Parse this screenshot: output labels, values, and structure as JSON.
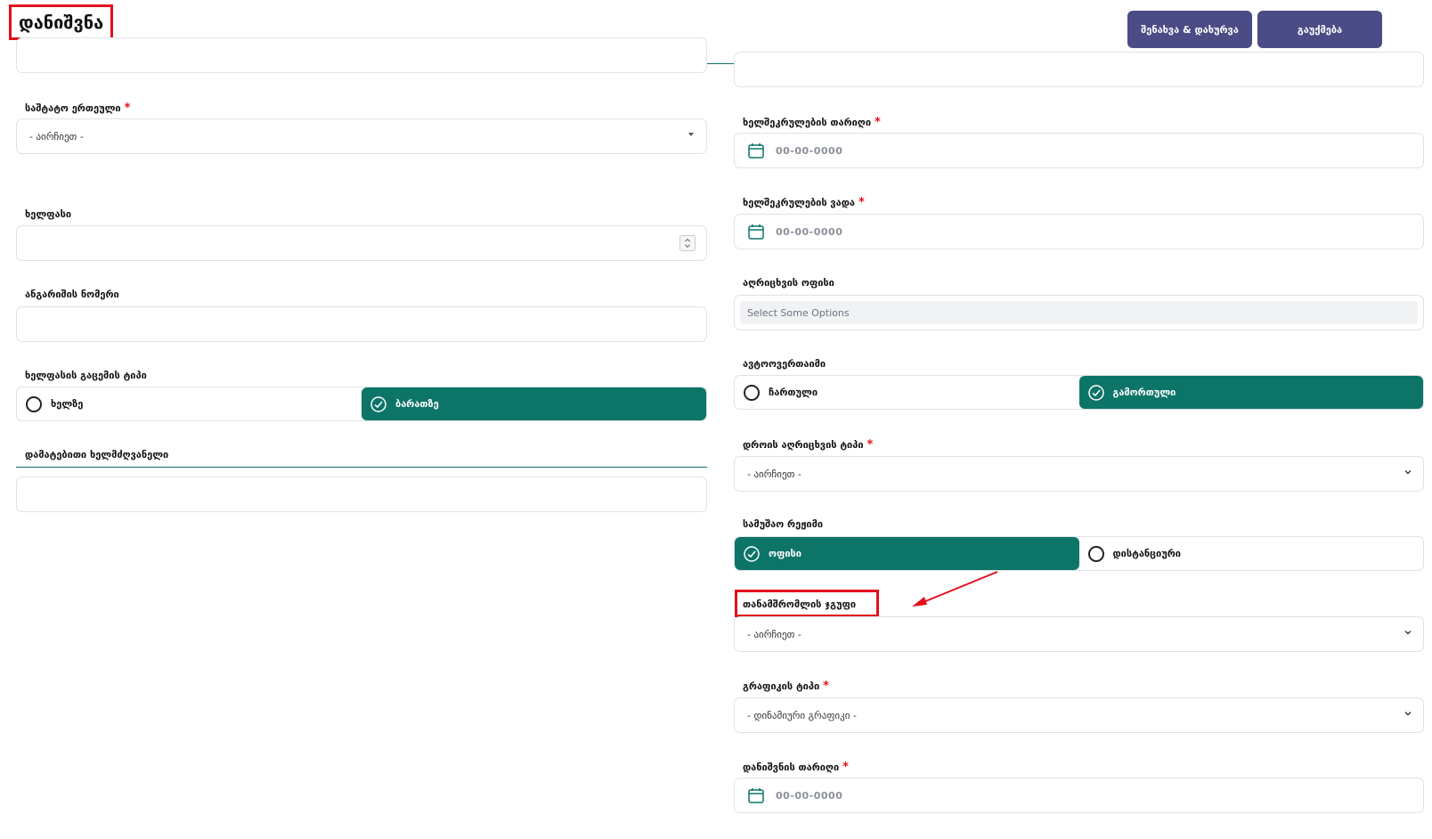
{
  "header": {
    "title": "დანიშვნა",
    "save_close_label": "შენახვა & დახურვა",
    "cancel_label": "გაუქმება"
  },
  "left": {
    "staff_unit": {
      "label": "საშტატო ერთეული",
      "value": "- აირჩიეთ -"
    },
    "salary": {
      "label": "ხელფასი",
      "value": ""
    },
    "account_number": {
      "label": "ანგარიშის ნომერი",
      "value": ""
    },
    "salary_type": {
      "label": "ხელფასის გაცემის ტიპი",
      "options": [
        "ხელზე",
        "ბარათზე"
      ],
      "selected": "ბარათზე"
    },
    "additional_manager": {
      "label": "დამატებითი ხელმძღვანელი",
      "value": ""
    }
  },
  "right": {
    "contract_date": {
      "label": "ხელშეკრულების თარიღი",
      "placeholder": "00-00-0000"
    },
    "contract_term": {
      "label": "ხელშეკრულების ვადა",
      "placeholder": "00-00-0000"
    },
    "registration_office": {
      "label": "აღრიცხვის ოფისი",
      "placeholder": "Select Some Options"
    },
    "auto_checkin": {
      "label": "ავტოოვერთაიმი",
      "options": [
        "ჩართული",
        "გამორთული"
      ],
      "selected": "გამორთული"
    },
    "time_tracking_type": {
      "label": "დროის აღრიცხვის ტიპი",
      "value": "- აირჩიეთ -"
    },
    "work_mode": {
      "label": "სამუშაო რეჟიმი",
      "options": [
        "ოფისი",
        "დისტანციური"
      ],
      "selected": "ოფისი"
    },
    "employee_group": {
      "label": "თანამშრომლის ჯგუფი",
      "value": "- აირჩიეთ -"
    },
    "schedule_type": {
      "label": "გრაფიკის ტიპი",
      "value": "- დინამიური გრაფიკი -"
    },
    "appointment_date": {
      "label": "დანიშვნის თარიღი",
      "placeholder": "00-00-0000"
    }
  },
  "colors": {
    "accent": "#0d7468",
    "button": "#4b4b86",
    "highlight": "#e3101b"
  }
}
